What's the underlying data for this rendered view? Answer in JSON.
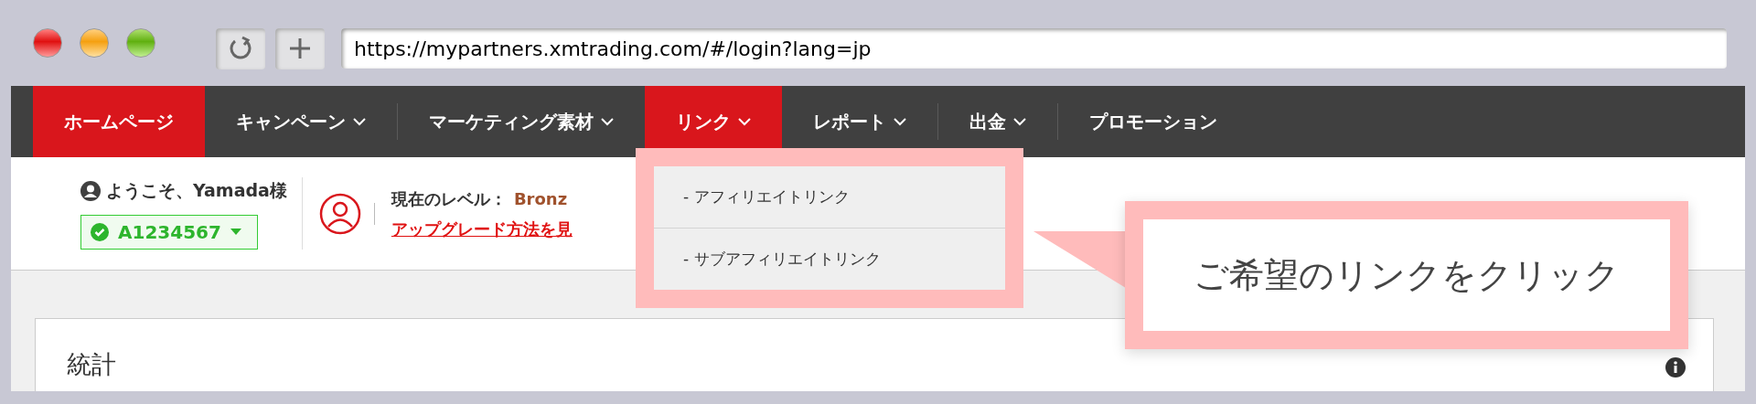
{
  "browser": {
    "url": "https://mypartners.xmtrading.com/#/login?lang=jp"
  },
  "nav": [
    {
      "label": "ホームページ",
      "selected": true,
      "has_menu": false
    },
    {
      "label": "キャンペーン",
      "selected": false,
      "has_menu": true
    },
    {
      "label": "マーケティング素材",
      "selected": false,
      "has_menu": true
    },
    {
      "label": "リンク",
      "selected": true,
      "has_menu": true
    },
    {
      "label": "レポート",
      "selected": false,
      "has_menu": true
    },
    {
      "label": "出金",
      "selected": false,
      "has_menu": true
    },
    {
      "label": "プロモーション",
      "selected": false,
      "has_menu": false
    }
  ],
  "welcome": "ようこそ、Yamada様",
  "account": "A1234567",
  "level_label": "現在のレベル：",
  "level_value": "Bronz",
  "upgrade_link": "アップグレード方法を見",
  "dropdown": [
    {
      "label": "- アフィリエイトリンク"
    },
    {
      "label": "- サブアフィリエイトリンク"
    }
  ],
  "callout": "ご希望のリンクをクリック",
  "card": {
    "title": "統計"
  }
}
